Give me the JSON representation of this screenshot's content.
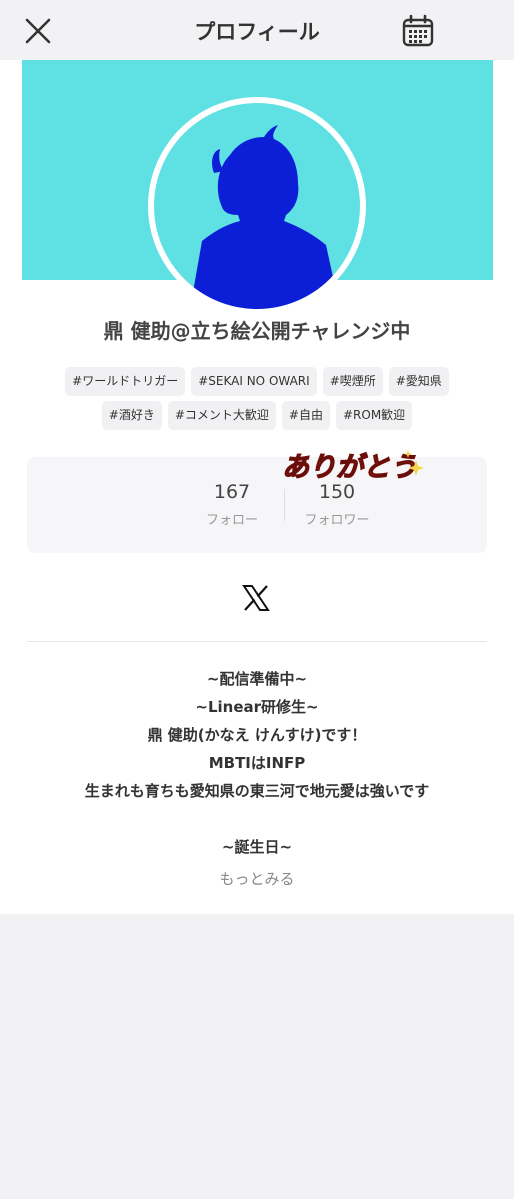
{
  "header": {
    "title": "プロフィール",
    "close_icon": "close-icon",
    "calendar_icon": "calendar-icon"
  },
  "profile": {
    "name": "鼎 健助@立ち絵公開チャレンジ中",
    "cover_color": "#5fe1e4",
    "avatar_color": "#0d1fd6",
    "tags_row1": [
      "#ワールドトリガー",
      "#SEKAI NO OWARI",
      "#喫煙所",
      "#愛知県"
    ],
    "tags_row2": [
      "#酒好き",
      "#コメント大歓迎",
      "#自由",
      "#ROM歓迎"
    ]
  },
  "stats": {
    "follow_count": "167",
    "follow_label": "フォロー",
    "follower_count": "150",
    "follower_label": "フォロワー"
  },
  "sticker_text": "ありがとう",
  "social_icon": "x-logo-icon",
  "bio": [
    "~配信準備中~",
    "~Linear研修生~",
    "鼎 健助(かなえ けんすけ)です！",
    "MBTIはINFP",
    "生まれも育ちも愛知県の東三河で地元愛は強いです",
    "",
    "~誕生日~"
  ],
  "more_label": "もっとみる"
}
